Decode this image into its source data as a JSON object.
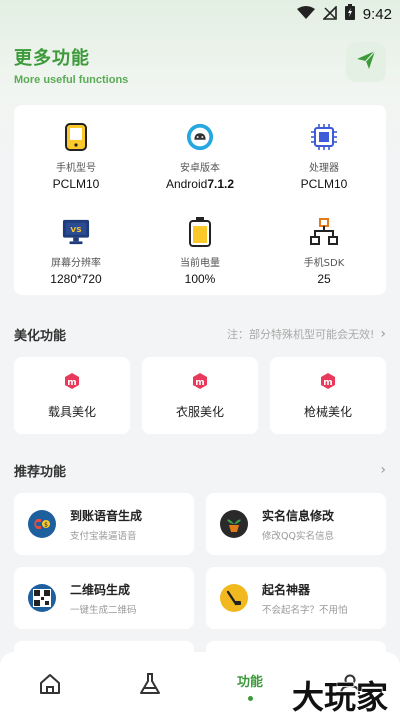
{
  "status": {
    "time": "9:42"
  },
  "header": {
    "title": "更多功能",
    "subtitle": "More useful functions"
  },
  "device_info": [
    {
      "label": "手机型号",
      "value": "PCLM10",
      "icon": "phone-icon"
    },
    {
      "label": "安卓版本",
      "value_prefix": "Android",
      "value_bold": "7.1.2",
      "icon": "android-icon"
    },
    {
      "label": "处理器",
      "value": "PCLM10",
      "icon": "chip-icon"
    },
    {
      "label": "屏幕分辨率",
      "value": "1280*720",
      "icon": "monitor-icon"
    },
    {
      "label": "当前电量",
      "value": "100%",
      "icon": "battery-icon"
    },
    {
      "label": "手机SDK",
      "value": "25",
      "icon": "network-icon"
    }
  ],
  "beautify": {
    "title": "美化功能",
    "note": "注：部分特殊机型可能会无效!",
    "items": [
      {
        "label": "载具美化",
        "icon": "vehicle-badge-icon"
      },
      {
        "label": "衣服美化",
        "icon": "clothes-badge-icon"
      },
      {
        "label": "枪械美化",
        "icon": "gun-badge-icon"
      }
    ]
  },
  "recommended": {
    "title": "推荐功能",
    "items": [
      {
        "title": "到账语音生成",
        "subtitle": "支付宝装逼语音",
        "icon": "voice-magnet-icon"
      },
      {
        "title": "实名信息修改",
        "subtitle": "修改QQ实名信息",
        "icon": "plant-pot-icon"
      },
      {
        "title": "二维码生成",
        "subtitle": "一键生成二维码",
        "icon": "qr-code-icon"
      },
      {
        "title": "起名神器",
        "subtitle": "不会起名字？不用怕",
        "icon": "naming-icon"
      }
    ]
  },
  "bottom_nav": {
    "active_label": "功能"
  },
  "watermark": "大玩家",
  "colors": {
    "accent": "#3c9a3a",
    "background": "#f3f4f5"
  }
}
